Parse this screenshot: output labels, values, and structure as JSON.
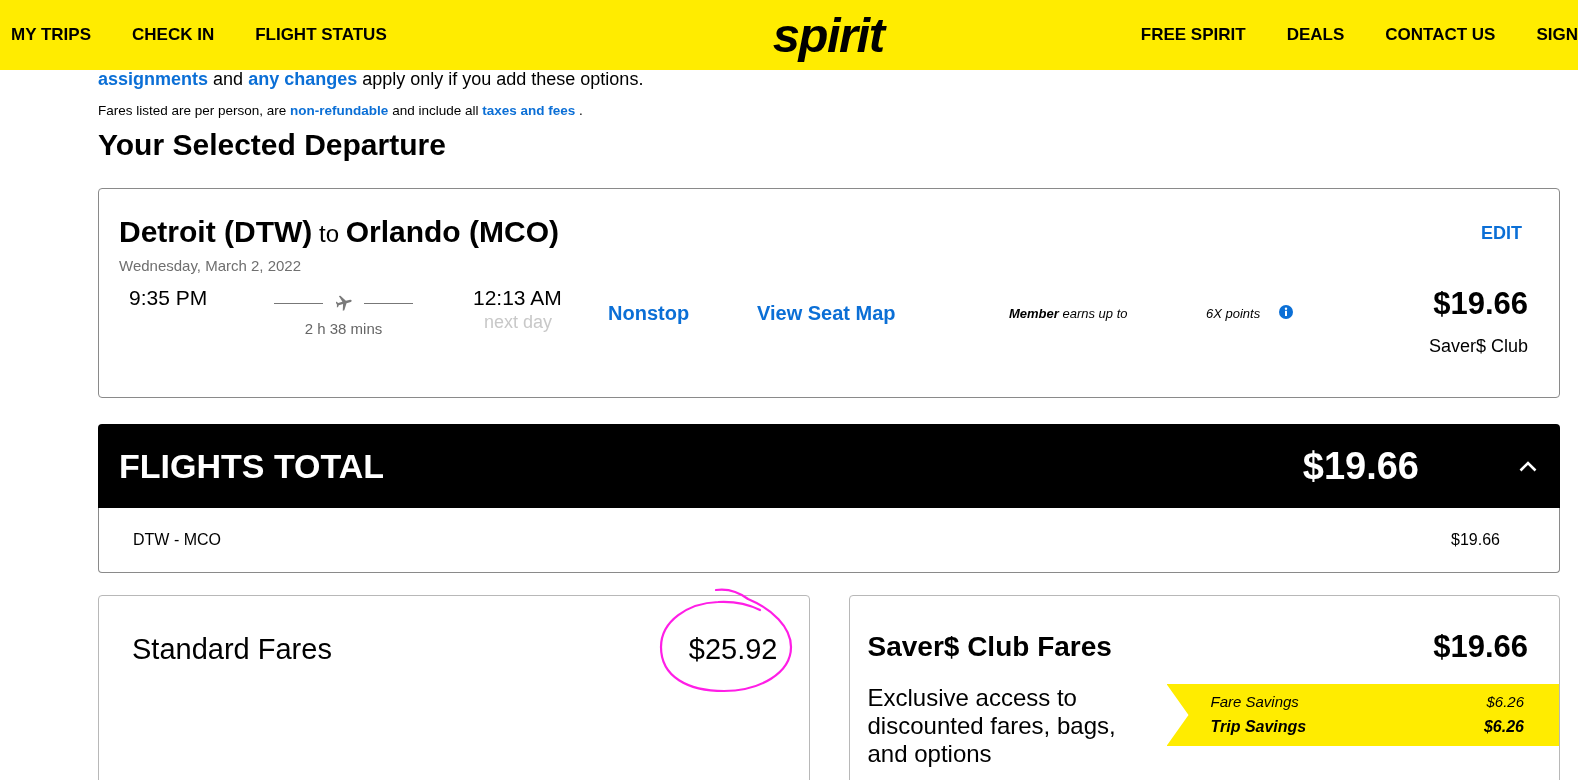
{
  "nav": {
    "left_links": [
      "MY TRIPS",
      "CHECK IN",
      "FLIGHT STATUS"
    ],
    "logo": "spirit",
    "right_links": [
      "FREE SPIRIT",
      "DEALS",
      "CONTACT US",
      "SIGN"
    ]
  },
  "notice": [
    {
      "kind": "link",
      "text": "assignments"
    },
    {
      "kind": "text",
      "text": "and"
    },
    {
      "kind": "link",
      "text": "any changes"
    },
    {
      "kind": "text",
      "text": "apply only if you add these options."
    }
  ],
  "fare_note": [
    {
      "kind": "text",
      "text": "Fares listed are per person, are"
    },
    {
      "kind": "link",
      "text": "non-refundable"
    },
    {
      "kind": "text",
      "text": "and include all"
    },
    {
      "kind": "link",
      "text": "taxes and fees"
    },
    {
      "kind": "text",
      "text": "."
    }
  ],
  "section_title": "Your Selected Departure",
  "departure": {
    "route": "**Detroit (DTW)** to **Orlando (MCO)**",
    "edit": "EDIT",
    "date": "Wednesday, March 2, 2022",
    "depart_time": "9:35 PM",
    "duration": "2 h 38 mins",
    "arrive_time": "12:13 AM",
    "arrive_note": "next day",
    "stops": "Nonstop",
    "seat_map": "View Seat Map",
    "member_text": "**Member** earns up to",
    "points": "6X points",
    "price": "$19.66",
    "fare_type": "Saver$ Club"
  },
  "flights_total": {
    "title": "FLIGHTS TOTAL",
    "amount": "$19.66",
    "expanded": true,
    "legs": [
      {
        "route": "DTW - MCO",
        "amount": "$19.66"
      }
    ]
  },
  "fare_options": [
    {
      "kind": "standard",
      "title": "Standard Fares",
      "price": "$25.92",
      "circled": true
    },
    {
      "kind": "club",
      "title": "Saver$ Club Fares",
      "price": "$19.66",
      "circled": false,
      "description": "Exclusive access to discounted fares, bags, and options",
      "savings": [
        {
          "kind": "line",
          "label": "Fare Savings",
          "amount": "$6.26"
        },
        {
          "kind": "total",
          "label": "Trip Savings",
          "amount": "$6.26"
        }
      ]
    }
  ]
}
